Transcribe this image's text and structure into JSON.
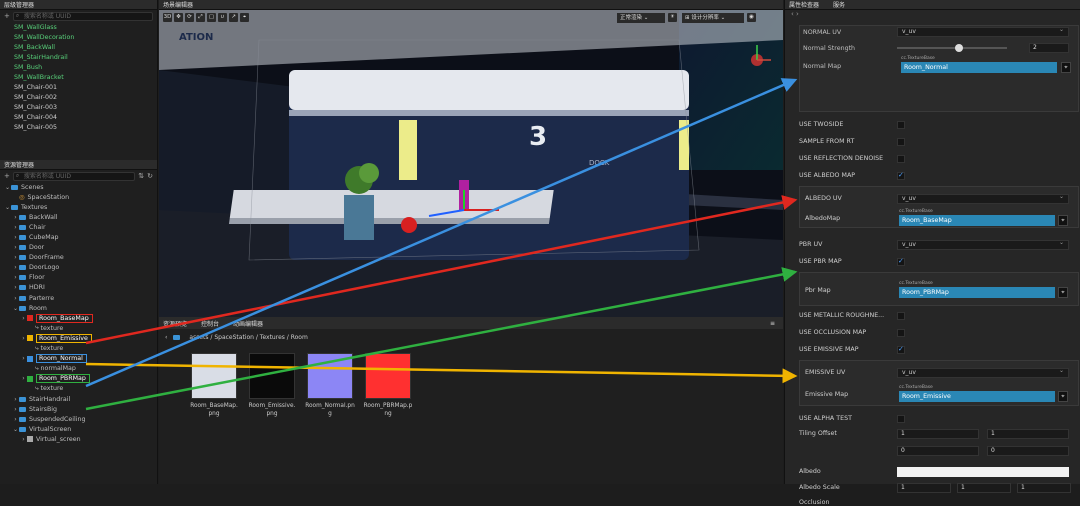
{
  "hierarchy": {
    "tab": "层级管理器",
    "search_placeholder": "搜索名称或 UUID",
    "items": [
      "SM_WallGlass",
      "SM_WallDecoration",
      "SM_BackWall",
      "SM_StairHandrail",
      "SM_Bush",
      "SM_WallBracket",
      "SM_Chair-001",
      "SM_Chair-002",
      "SM_Chair-003",
      "SM_Chair-004",
      "SM_Chair-005"
    ]
  },
  "assets": {
    "tab": "资源管理器",
    "search_placeholder": "搜索名称或 UUID",
    "tree": [
      {
        "label": "Scenes",
        "type": "folder",
        "indent": 0,
        "open": true
      },
      {
        "label": "SpaceStation",
        "type": "scene",
        "indent": 1
      },
      {
        "label": "Textures",
        "type": "folder",
        "indent": 0,
        "open": true
      },
      {
        "label": "BackWall",
        "type": "folder",
        "indent": 1
      },
      {
        "label": "Chair",
        "type": "folder",
        "indent": 1
      },
      {
        "label": "CubeMap",
        "type": "folder",
        "indent": 1
      },
      {
        "label": "Door",
        "type": "folder",
        "indent": 1
      },
      {
        "label": "DoorFrame",
        "type": "folder",
        "indent": 1
      },
      {
        "label": "DoorLogo",
        "type": "folder",
        "indent": 1
      },
      {
        "label": "Floor",
        "type": "folder",
        "indent": 1
      },
      {
        "label": "HDRI",
        "type": "folder",
        "indent": 1
      },
      {
        "label": "Parterre",
        "type": "folder",
        "indent": 1
      },
      {
        "label": "Room",
        "type": "folder",
        "indent": 1,
        "open": true
      },
      {
        "label": "Room_BaseMap",
        "type": "image",
        "indent": 2,
        "highlight": "#e0281f"
      },
      {
        "label": "texture",
        "type": "sub",
        "indent": 3
      },
      {
        "label": "Room_Emissive",
        "type": "image",
        "indent": 2,
        "highlight": "#f0b400"
      },
      {
        "label": "texture",
        "type": "sub",
        "indent": 3
      },
      {
        "label": "Room_Normal",
        "type": "image",
        "indent": 2,
        "highlight": "#3a90e0"
      },
      {
        "label": "normalMap",
        "type": "sub",
        "indent": 3
      },
      {
        "label": "Room_PBRMap",
        "type": "image",
        "indent": 2,
        "highlight": "#2fb040"
      },
      {
        "label": "texture",
        "type": "sub",
        "indent": 3
      },
      {
        "label": "StairHandrail",
        "type": "folder",
        "indent": 1
      },
      {
        "label": "StairsBig",
        "type": "folder",
        "indent": 1
      },
      {
        "label": "SuspendedCeiling",
        "type": "folder",
        "indent": 1
      },
      {
        "label": "VirtualScreen",
        "type": "folder",
        "indent": 1,
        "open": true
      },
      {
        "label": "Virtual_screen",
        "type": "image",
        "indent": 2
      }
    ]
  },
  "scene_editor": {
    "tab": "场景编辑器",
    "mode_3d": "3D",
    "render_mode": "正常渲染",
    "resolution": "设计分辨率",
    "door_text": "DOCK",
    "door_number": "3",
    "logo_text": "ATION"
  },
  "bottom_panel": {
    "tabs": [
      "资源预览",
      "控制台",
      "动画编辑器"
    ],
    "breadcrumb": "assets / SpaceStation / Textures / Room",
    "thumbs": [
      {
        "name": "Room_BaseMap.png",
        "color": "#d9dde6"
      },
      {
        "name": "Room_Emissive.png",
        "color": "#0a0a0a"
      },
      {
        "name": "Room_Normal.png",
        "color": "#8c86f5"
      },
      {
        "name": "Room_PBRMap.png",
        "color": "#ff3030"
      }
    ]
  },
  "inspector": {
    "tabs": [
      "属性检查器",
      "服务"
    ],
    "normal_uv_label": "NORMAL UV",
    "normal_uv_value": "v_uv",
    "normal_strength_label": "Normal Strength",
    "normal_strength_value": "2",
    "normal_map_label": "Normal Map",
    "asset_type": "cc.TextureBase",
    "normal_map_value": "Room_Normal",
    "use_twoside": "USE TWOSIDE",
    "sample_from_rt": "SAMPLE FROM RT",
    "use_reflection_denoise": "USE REFLECTION DENOISE",
    "use_albedo_map": "USE ALBEDO MAP",
    "albedo_uv_label": "ALBEDO UV",
    "albedo_uv_value": "v_uv",
    "albedo_map_label": "AlbedoMap",
    "albedo_map_value": "Room_BaseMap",
    "pbr_uv_label": "PBR UV",
    "pbr_uv_value": "v_uv",
    "use_pbr_map": "USE PBR MAP",
    "pbr_map_label": "Pbr Map",
    "pbr_map_value": "Room_PBRMap",
    "use_metallic": "USE METALLIC ROUGHNE...",
    "use_occlusion": "USE OCCLUSION MAP",
    "use_emissive_map": "USE EMISSIVE MAP",
    "emissive_uv_label": "EMISSIVE UV",
    "emissive_uv_value": "v_uv",
    "emissive_map_label": "Emissive Map",
    "emissive_map_value": "Room_Emissive",
    "use_alpha_test": "USE ALPHA TEST",
    "tiling_offset_label": "Tiling Offset",
    "tiling": [
      "1",
      "1",
      "0",
      "0"
    ],
    "albedo_label": "Albedo",
    "albedo_scale_label": "Albedo Scale",
    "albedo_scale": [
      "1",
      "1",
      "1"
    ],
    "last_label": "Occlusion"
  },
  "colors": {
    "red": "#e0281f",
    "yellow": "#f0b400",
    "blue": "#3a90e0",
    "green": "#2fb040",
    "accent": "#2a87b5"
  }
}
